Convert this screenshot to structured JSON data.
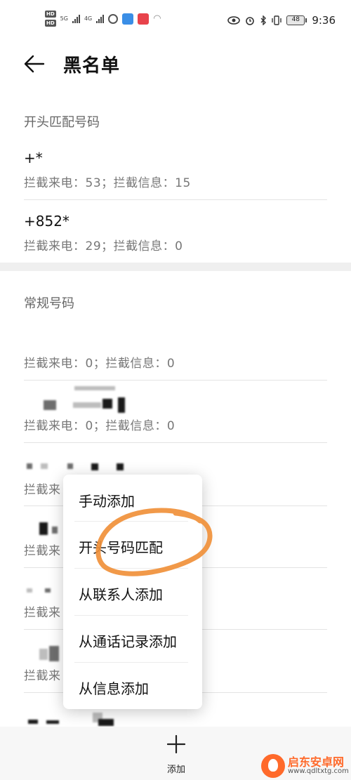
{
  "status_bar": {
    "hd_label": "HD",
    "network_1": "5G",
    "network_2": "4G",
    "battery": "48",
    "time": "9:36"
  },
  "header": {
    "title": "黑名单"
  },
  "prefix_section": {
    "title": "开头匹配号码",
    "entries": [
      {
        "number": "+*",
        "stats": "拦截来电：53；拦截信息：15"
      },
      {
        "number": "+852*",
        "stats": "拦截来电：29；拦截信息：0"
      }
    ]
  },
  "regular_section": {
    "title": "常规号码",
    "entries": [
      {
        "stats": "拦截来电：0；拦截信息：0"
      },
      {
        "stats": "拦截来电：0；拦截信息：0"
      },
      {
        "stats": "拦截来"
      },
      {
        "stats": "拦截来"
      },
      {
        "stats": "拦截来"
      },
      {
        "stats": "拦截来"
      }
    ]
  },
  "popup_menu": {
    "items": [
      {
        "label": "手动添加"
      },
      {
        "label": "开头号码匹配"
      },
      {
        "label": "从联系人添加"
      },
      {
        "label": "从通话记录添加"
      },
      {
        "label": "从信息添加"
      }
    ]
  },
  "bottom_bar": {
    "add_label": "添加"
  },
  "watermark": {
    "name": "启东安卓网",
    "url": "www.qdltxtg.com"
  },
  "colors": {
    "highlight": "#f0903a",
    "watermark": "#ff6a2b",
    "divider": "#e3e3e3"
  }
}
